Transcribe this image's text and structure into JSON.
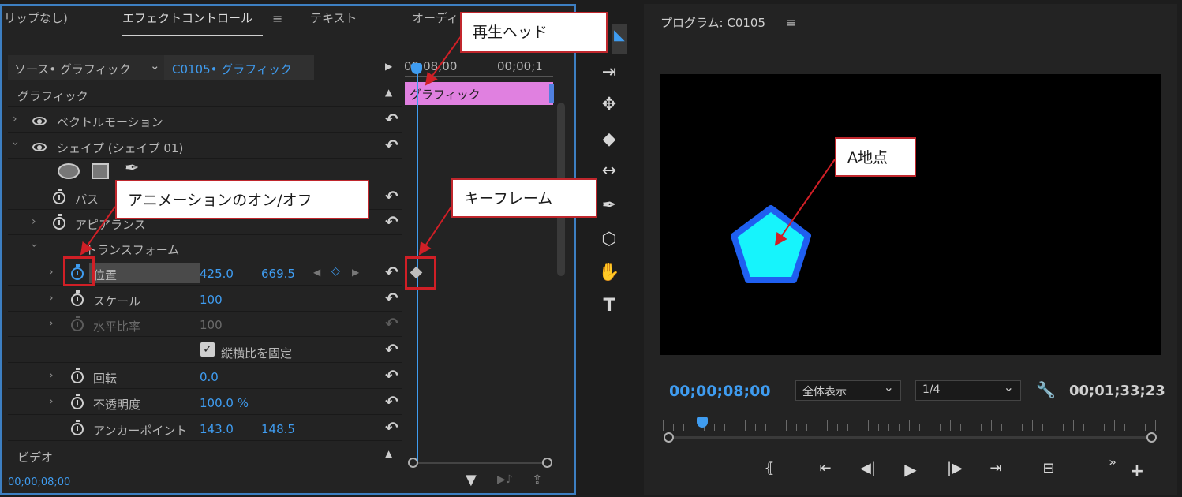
{
  "effect_panel": {
    "tabs": [
      "リップなし)",
      "エフェクトコントロール",
      "テキスト",
      "オーディ"
    ],
    "source_label": "ソース• グラフィック",
    "sequence_label": "C0105• グラフィック",
    "timecode_start": "00;08;00",
    "timecode_end": "00;00;1",
    "clip_label": "グラフィック",
    "section_graphic": "グラフィック",
    "section_video": "ビデオ",
    "rows": {
      "vector_motion": "ベクトルモーション",
      "shape": "シェイプ (シェイプ 01)",
      "path": "パス",
      "appearance": "アピアランス",
      "transform": "トランスフォーム",
      "position": "位置",
      "position_x": "425.0",
      "position_y": "669.5",
      "scale": "スケール",
      "scale_value": "100",
      "scale_h": "水平比率",
      "scale_h_value": "100",
      "uniform_scale": "縦横比を固定",
      "rotation": "回転",
      "rotation_value": "0.0",
      "opacity": "不透明度",
      "opacity_value": "100.0 %",
      "anchor": "アンカーポイント",
      "anchor_x": "143.0",
      "anchor_y": "148.5"
    },
    "footer_timecode": "00;00;08;00"
  },
  "callouts": {
    "playhead": "再生ヘッド",
    "animation_toggle": "アニメーションのオン/オフ",
    "keyframe": "キーフレーム",
    "point_a": "A地点"
  },
  "program_panel": {
    "title": "プログラム: C0105",
    "timecode": "00;00;08;00",
    "zoom": "全体表示",
    "resolution": "1/4",
    "duration": "00;01;33;23"
  },
  "colors": {
    "accent": "#3f9cf0",
    "clip": "#e080e0",
    "pentagon_fill": "#16f4fc",
    "pentagon_stroke": "#1f5ff0",
    "callout_border": "#c0272d"
  }
}
